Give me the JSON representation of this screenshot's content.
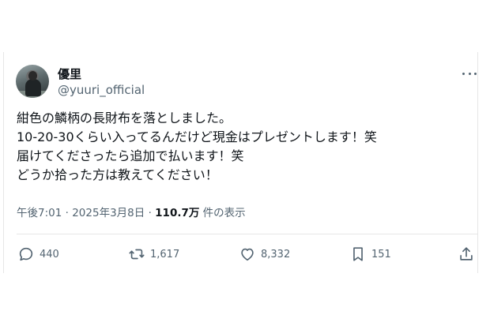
{
  "tweet": {
    "display_name": "優里",
    "handle": "@yuuri_official",
    "lines": [
      "紺色の鱗柄の長財布を落としました。",
      "10-20-30くらい入ってるんだけど現金はプレゼントします！笑",
      "届けてくださったら追加で払います！笑",
      "どうか拾った方は教えてください！"
    ],
    "time": "午後7:01",
    "date": "2025年3月8日",
    "separator": "·",
    "views_count": "110.7万",
    "views_label": "件の表示"
  },
  "actions": {
    "replies": "440",
    "retweets": "1,617",
    "likes": "8,332",
    "bookmarks": "151"
  },
  "icons": {
    "more": "more-horizontal-icon",
    "reply": "reply-icon",
    "retweet": "retweet-icon",
    "like": "heart-icon",
    "bookmark": "bookmark-icon",
    "share": "share-icon"
  },
  "colors": {
    "text_primary": "#0f1419",
    "text_secondary": "#536471",
    "border": "#e6e6e6"
  }
}
